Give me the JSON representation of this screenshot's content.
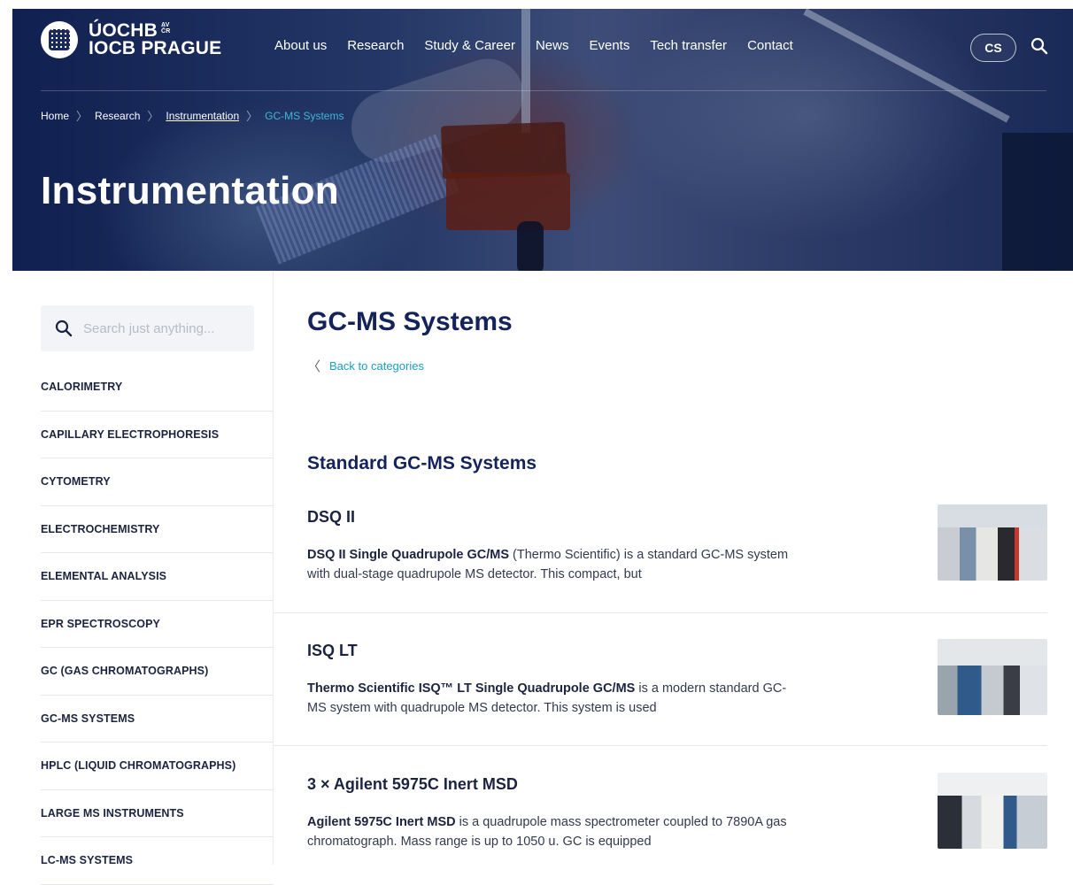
{
  "header": {
    "logo_line1": "ÚOCHB",
    "logo_sub_top": "AV",
    "logo_sub_bottom": "ČR",
    "logo_line2": "IOCB PRAGUE",
    "nav": [
      "About us",
      "Research",
      "Study & Career",
      "News",
      "Events",
      "Tech transfer",
      "Contact"
    ],
    "lang": "CS"
  },
  "breadcrumb": {
    "items": [
      "Home",
      "Research",
      "Instrumentation",
      "GC-MS Systems"
    ]
  },
  "hero_title": "Instrumentation",
  "sidebar": {
    "search_placeholder": "Search just anything...",
    "categories": [
      "CALORIMETRY",
      "CAPILLARY ELECTROPHORESIS",
      "CYTOMETRY",
      "ELECTROCHEMISTRY",
      "ELEMENTAL ANALYSIS",
      "EPR SPECTROSCOPY",
      "GC (GAS CHROMATOGRAPHS)",
      "GC-MS SYSTEMS",
      "HPLC (LIQUID CHROMATOGRAPHS)",
      "LARGE MS INSTRUMENTS",
      "LC-MS SYSTEMS"
    ]
  },
  "main": {
    "title": "GC-MS Systems",
    "back_label": "Back to categories",
    "section_title": "Standard GC-MS Systems",
    "entries": [
      {
        "title": "DSQ II",
        "bold": "DSQ II Single Quadrupole GC/MS",
        "text": " (Thermo Scientific) is a standard GC-MS system with dual-stage quadrupole MS detector. This compact, but"
      },
      {
        "title": "ISQ LT",
        "bold": "Thermo Scientific ISQ™ LT Single Quadrupole GC/MS",
        "text": " is a modern standard GC-MS system with quadrupole MS detector. This system is used"
      },
      {
        "title": "3 × Agilent 5975C Inert MSD",
        "bold": "Agilent 5975C Inert MSD",
        "text": " is a quadrupole mass spectrometer coupled to 7890A gas chromatograph. Mass range is up to 1050 u. GC is equipped"
      }
    ]
  },
  "colors": {
    "navy": "#14245a",
    "accent_cyan": "#1a9dc4",
    "breadcrumb_current": "#3fb6d9"
  }
}
